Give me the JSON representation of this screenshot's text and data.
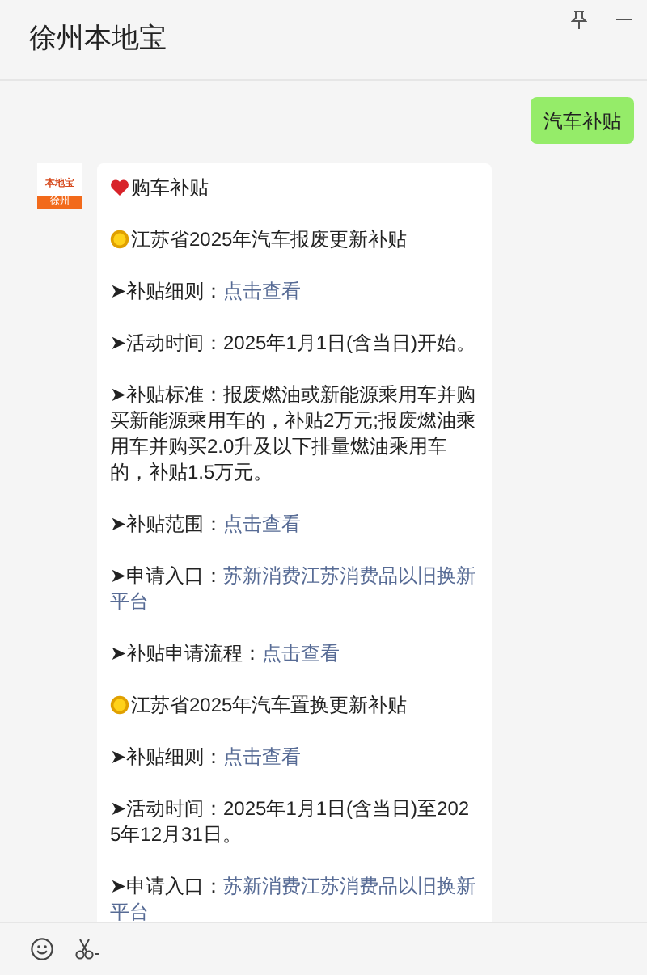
{
  "window": {
    "title": "徐州本地宝"
  },
  "messages": [
    {
      "kind": "outgoing",
      "text": "汽车补贴"
    },
    {
      "kind": "incoming",
      "avatar": {
        "brand": "本地宝",
        "city": "徐州"
      },
      "paragraphs": [
        {
          "kind": "heart",
          "text": "购车补贴"
        },
        {
          "kind": "sun",
          "text": "江苏省2025年汽车报废更新补贴"
        },
        {
          "kind": "item",
          "text": "➤补贴细则：",
          "link": "点击查看"
        },
        {
          "kind": "item",
          "text": "➤活动时间：2025年1月1日(含当日)开始。"
        },
        {
          "kind": "item",
          "text": "➤补贴标准：报废燃油或新能源乘用车并购买新能源乘用车的，补贴2万元;报废燃油乘用车并购买2.0升及以下排量燃油乘用车的，补贴1.5万元。"
        },
        {
          "kind": "item",
          "text": "➤补贴范围：",
          "link": "点击查看"
        },
        {
          "kind": "item",
          "text": "➤申请入口：",
          "link_lines": [
            "苏新消费江苏消费品以旧换新",
            "平台"
          ]
        },
        {
          "kind": "item",
          "text": "➤补贴申请流程：",
          "link": "点击查看"
        },
        {
          "kind": "sun",
          "text": "江苏省2025年汽车置换更新补贴"
        },
        {
          "kind": "item",
          "text": "➤补贴细则：",
          "link": "点击查看"
        },
        {
          "kind": "item",
          "text": "➤活动时间：2025年1月1日(含当日)至2025年12月31日。"
        },
        {
          "kind": "item",
          "text": "➤申请入口：",
          "link_lines": [
            "苏新消费江苏消费品以旧换新",
            "平台"
          ]
        }
      ]
    }
  ]
}
